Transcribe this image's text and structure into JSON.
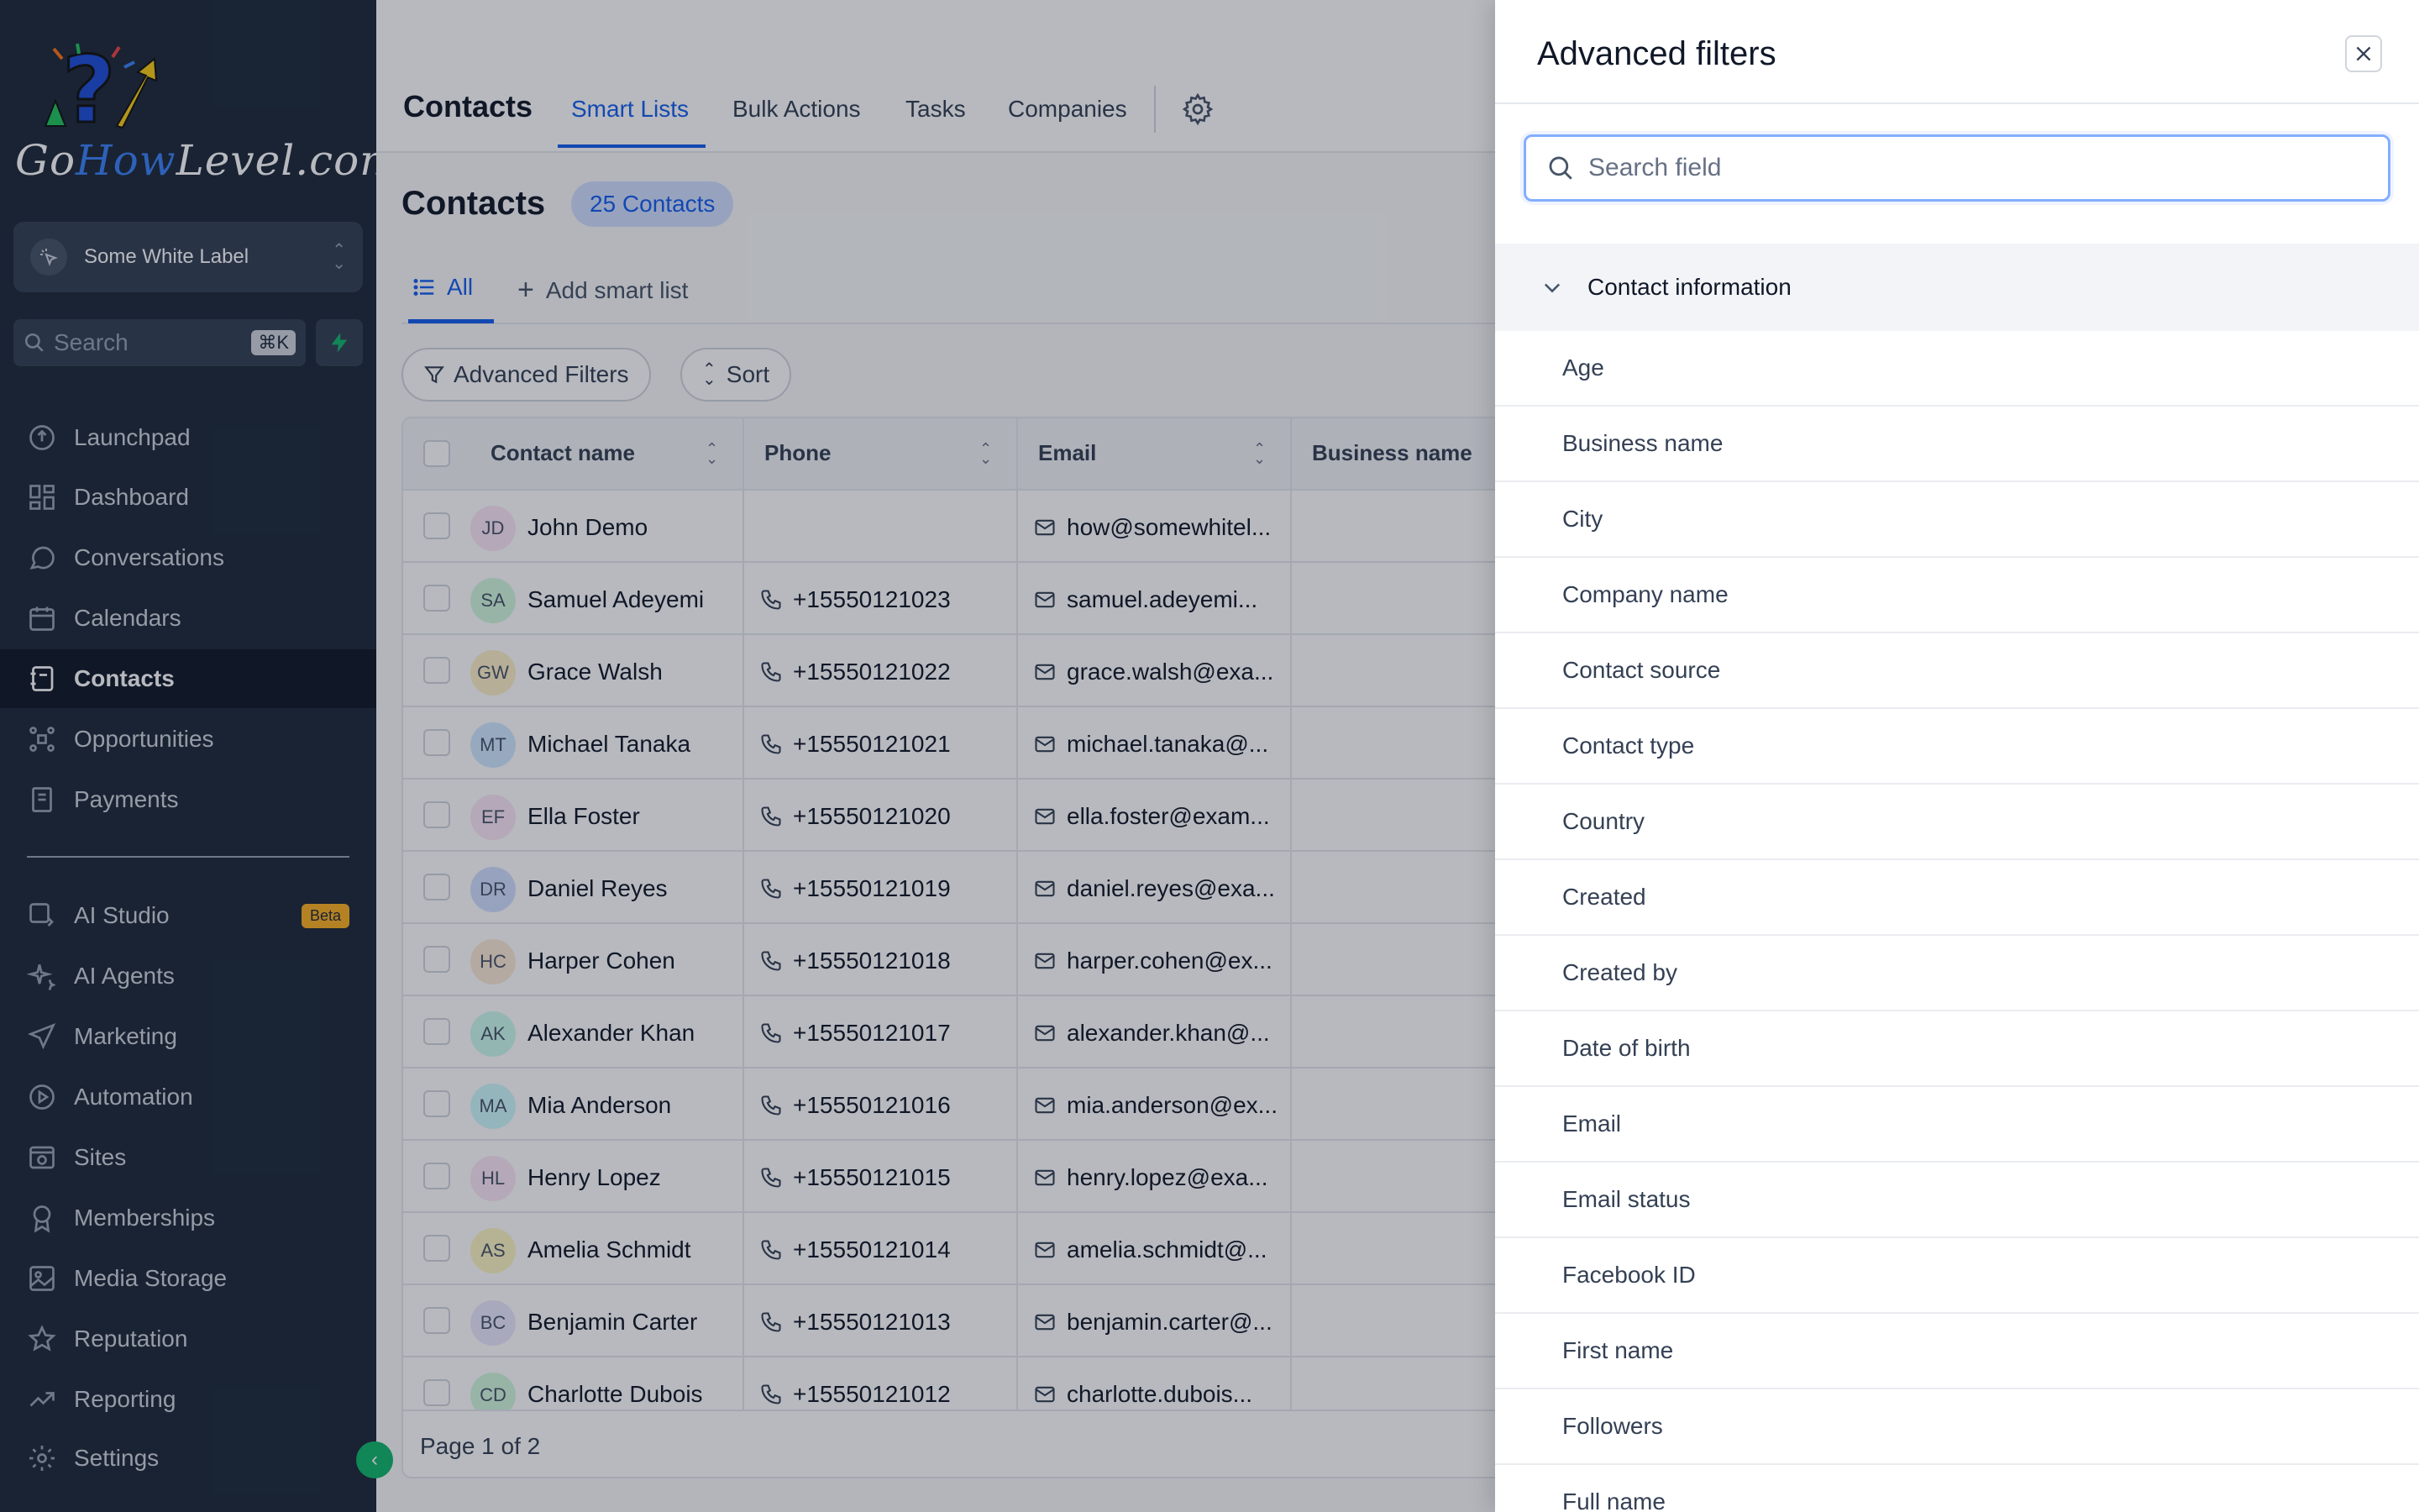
{
  "brand": {
    "logo_text_a": "Go",
    "logo_text_b": "How",
    "logo_text_c": "Level",
    "logo_text_d": ".com"
  },
  "account": {
    "name": "Some White Label"
  },
  "sidebar_search": {
    "placeholder": "Search",
    "shortcut": "⌘K"
  },
  "nav": {
    "launchpad": "Launchpad",
    "dashboard": "Dashboard",
    "conversations": "Conversations",
    "calendars": "Calendars",
    "contacts": "Contacts",
    "opportunities": "Opportunities",
    "payments": "Payments",
    "ai_studio": "AI Studio",
    "ai_studio_badge": "Beta",
    "ai_agents": "AI Agents",
    "marketing": "Marketing",
    "automation": "Automation",
    "sites": "Sites",
    "memberships": "Memberships",
    "media_storage": "Media Storage",
    "reputation": "Reputation",
    "reporting": "Reporting",
    "settings": "Settings"
  },
  "topbar": {
    "title": "Contacts",
    "tabs": [
      "Smart Lists",
      "Bulk Actions",
      "Tasks",
      "Companies"
    ]
  },
  "page": {
    "title": "Contacts",
    "count": "25 Contacts"
  },
  "list_tabs": {
    "all": "All",
    "add": "Add smart list"
  },
  "toolbar": {
    "filters": "Advanced Filters",
    "sort": "Sort"
  },
  "table": {
    "headers": [
      "Contact name",
      "Phone",
      "Email",
      "Business name"
    ],
    "rows": [
      {
        "initials": "JD",
        "name": "John Demo",
        "phone": "",
        "email": "how@somewhitel...",
        "color": "#fce7f6"
      },
      {
        "initials": "SA",
        "name": "Samuel Adeyemi",
        "phone": "+15550121023",
        "email": "samuel.adeyemi...",
        "color": "#d3f8df"
      },
      {
        "initials": "GW",
        "name": "Grace Walsh",
        "phone": "+15550121022",
        "email": "grace.walsh@exa...",
        "color": "#fef0c7"
      },
      {
        "initials": "MT",
        "name": "Michael Tanaka",
        "phone": "+15550121021",
        "email": "michael.tanaka@...",
        "color": "#d1e9ff"
      },
      {
        "initials": "EF",
        "name": "Ella Foster",
        "phone": "+15550121020",
        "email": "ella.foster@exam...",
        "color": "#fce7f6"
      },
      {
        "initials": "DR",
        "name": "Daniel Reyes",
        "phone": "+15550121019",
        "email": "daniel.reyes@exa...",
        "color": "#d1e0ff"
      },
      {
        "initials": "HC",
        "name": "Harper Cohen",
        "phone": "+15550121018",
        "email": "harper.cohen@ex...",
        "color": "#fdead7"
      },
      {
        "initials": "AK",
        "name": "Alexander Khan",
        "phone": "+15550121017",
        "email": "alexander.khan@...",
        "color": "#ccfbef"
      },
      {
        "initials": "MA",
        "name": "Mia Anderson",
        "phone": "+15550121016",
        "email": "mia.anderson@ex...",
        "color": "#cff9fe"
      },
      {
        "initials": "HL",
        "name": "Henry Lopez",
        "phone": "+15550121015",
        "email": "henry.lopez@exa...",
        "color": "#fce7f6"
      },
      {
        "initials": "AS",
        "name": "Amelia Schmidt",
        "phone": "+15550121014",
        "email": "amelia.schmidt@...",
        "color": "#fef7c3"
      },
      {
        "initials": "BC",
        "name": "Benjamin Carter",
        "phone": "+15550121013",
        "email": "benjamin.carter@...",
        "color": "#ebe9fe"
      },
      {
        "initials": "CD",
        "name": "Charlotte Dubois",
        "phone": "+15550121012",
        "email": "charlotte.dubois...",
        "color": "#d3f8df"
      }
    ],
    "footer": "Page 1 of 2"
  },
  "drawer": {
    "title": "Advanced filters",
    "search_placeholder": "Search field",
    "group": "Contact information",
    "fields": [
      "Age",
      "Business name",
      "City",
      "Company name",
      "Contact source",
      "Contact type",
      "Country",
      "Created",
      "Created by",
      "Date of birth",
      "Email",
      "Email status",
      "Facebook ID",
      "First name",
      "Followers",
      "Full name"
    ]
  },
  "colors": {
    "sidebar_bg": "#1d2939",
    "accent": "#155eef",
    "active_nav": "#101828"
  }
}
